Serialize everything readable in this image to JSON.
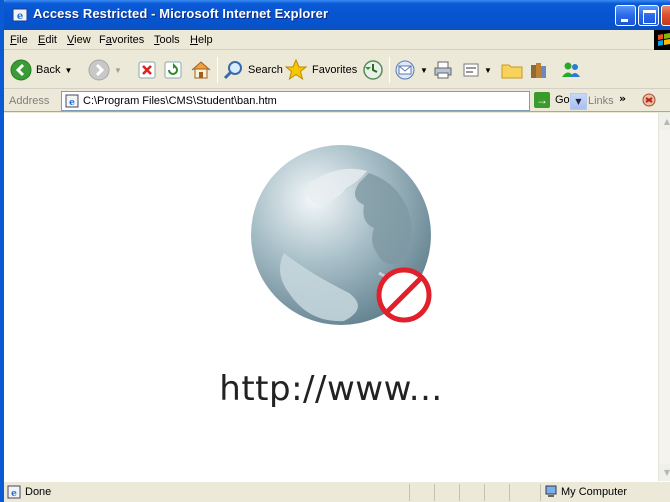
{
  "window": {
    "title": "Access Restricted - Microsoft Internet Explorer"
  },
  "menu": {
    "items": [
      {
        "label": "File",
        "underline": "F",
        "rest": "ile"
      },
      {
        "label": "Edit",
        "underline": "E",
        "rest": "dit"
      },
      {
        "label": "View",
        "underline": "V",
        "rest": "iew"
      },
      {
        "label": "Favorites",
        "pre": "F",
        "underline": "a",
        "rest": "vorites"
      },
      {
        "label": "Tools",
        "underline": "T",
        "rest": "ools"
      },
      {
        "label": "Help",
        "underline": "H",
        "rest": "elp"
      }
    ]
  },
  "toolbar": {
    "back_label": "Back",
    "search_label": "Search",
    "favorites_label": "Favorites"
  },
  "address": {
    "label": "Address",
    "value": "C:\\Program Files\\CMS\\Student\\ban.htm",
    "go_label": "Go",
    "links_label": "Links",
    "links_chevron": "»"
  },
  "content": {
    "url_text": "http://www..."
  },
  "status": {
    "text": "Done",
    "zone": "My Computer"
  },
  "colors": {
    "titlebar": "#0a5ad6",
    "chrome": "#ece9d8",
    "ban_red": "#e0202a"
  }
}
